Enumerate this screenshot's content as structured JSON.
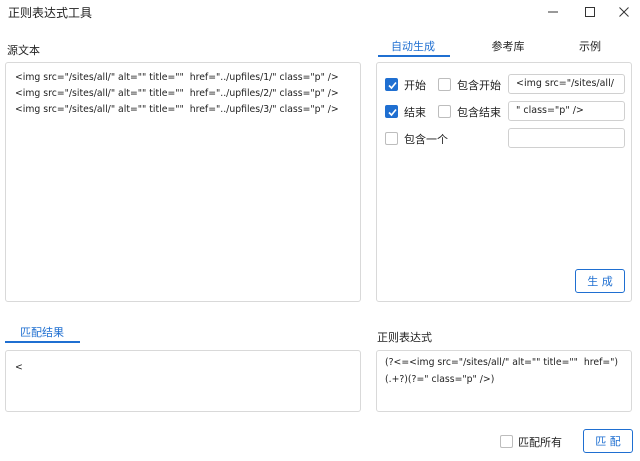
{
  "window": {
    "title": "正则表达式工具",
    "controls": {
      "minimize_icon": "minimize-icon",
      "maximize_icon": "maximize-icon",
      "close_icon": "close-icon"
    }
  },
  "source": {
    "label": "源文本",
    "lines": [
      "<img src=\"/sites/all/\" alt=\"\" title=\"\"  href=\"../upfiles/1/\" class=\"p\" />",
      "<img src=\"/sites/all/\" alt=\"\" title=\"\"  href=\"../upfiles/2/\" class=\"p\" />",
      "<img src=\"/sites/all/\" alt=\"\" title=\"\"  href=\"../upfiles/3/\" class=\"p\" />"
    ]
  },
  "tabs": [
    "自动生成",
    "参考库",
    "示例"
  ],
  "auto": {
    "rows": [
      {
        "check_label": "开始",
        "checked": true,
        "include_label": "包含开始",
        "include_checked": false,
        "value": "<img src=\"/sites/all/"
      },
      {
        "check_label": "结束",
        "checked": true,
        "include_label": "包含结束",
        "include_checked": false,
        "value": "\" class=\"p\" />"
      }
    ],
    "include_one_label": "包含一个",
    "include_one_checked": false,
    "include_one_value": "",
    "generate_label": "生 成"
  },
  "match": {
    "tab_label": "匹配结果",
    "result": "<"
  },
  "regex": {
    "label": "正则表达式",
    "lines": [
      "(?<=<img src=\"/sites/all/\" alt=\"\" title=\"\"  href=\")",
      "(.+?)(?=\" class=\"p\" />)"
    ]
  },
  "footer": {
    "match_all_label": "匹配所有",
    "match_all_checked": false,
    "match_button_label": "匹 配"
  },
  "colors": {
    "accent": "#1f6fd1",
    "border": "#d9d9d9"
  }
}
